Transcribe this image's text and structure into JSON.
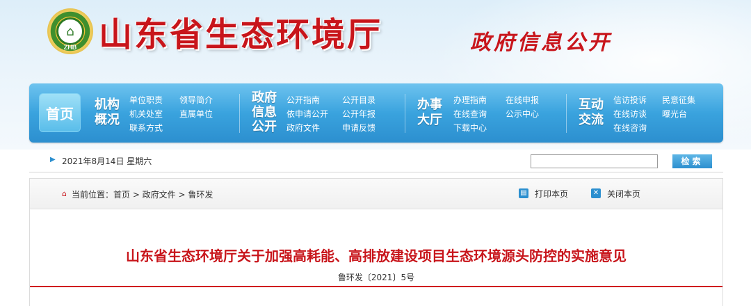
{
  "header": {
    "logo_text": "ZHB",
    "site_title": "山东省生态环境厅",
    "sub_title": "政府信息公开"
  },
  "nav": {
    "home": "首页",
    "groups": [
      {
        "title_lines": [
          "机构",
          "概况"
        ],
        "links": [
          "单位职责",
          "领导简介",
          "机关处室",
          "直属单位",
          "联系方式"
        ]
      },
      {
        "title_lines": [
          "政府",
          "信息",
          "公开"
        ],
        "links": [
          "公开指南",
          "公开目录",
          "依申请公开",
          "公开年报",
          "政府文件",
          "申请反馈"
        ]
      },
      {
        "title_lines": [
          "办事",
          "大厅"
        ],
        "links": [
          "办理指南",
          "在线申报",
          "在线查询",
          "公示中心",
          "下载中心"
        ]
      },
      {
        "title_lines": [
          "互动",
          "交流"
        ],
        "links": [
          "信访投诉",
          "民意征集",
          "在线访谈",
          "曝光台",
          "在线咨询"
        ]
      }
    ]
  },
  "datebar": {
    "date": "2021年8月14日 星期六",
    "search_value": "",
    "search_button": "检索"
  },
  "breadcrumb": {
    "text": "当前位置：首页 > 政府文件 > 鲁环发"
  },
  "tools": {
    "print": "打印本页",
    "close": "关闭本页"
  },
  "document": {
    "title": "山东省生态环境厅关于加强高耗能、高排放建设项目生态环境源头防控的实施意见",
    "number": "鲁环发〔2021〕5号"
  },
  "colors": {
    "brand_red": "#c8151b",
    "nav_blue": "#3aa3de"
  }
}
